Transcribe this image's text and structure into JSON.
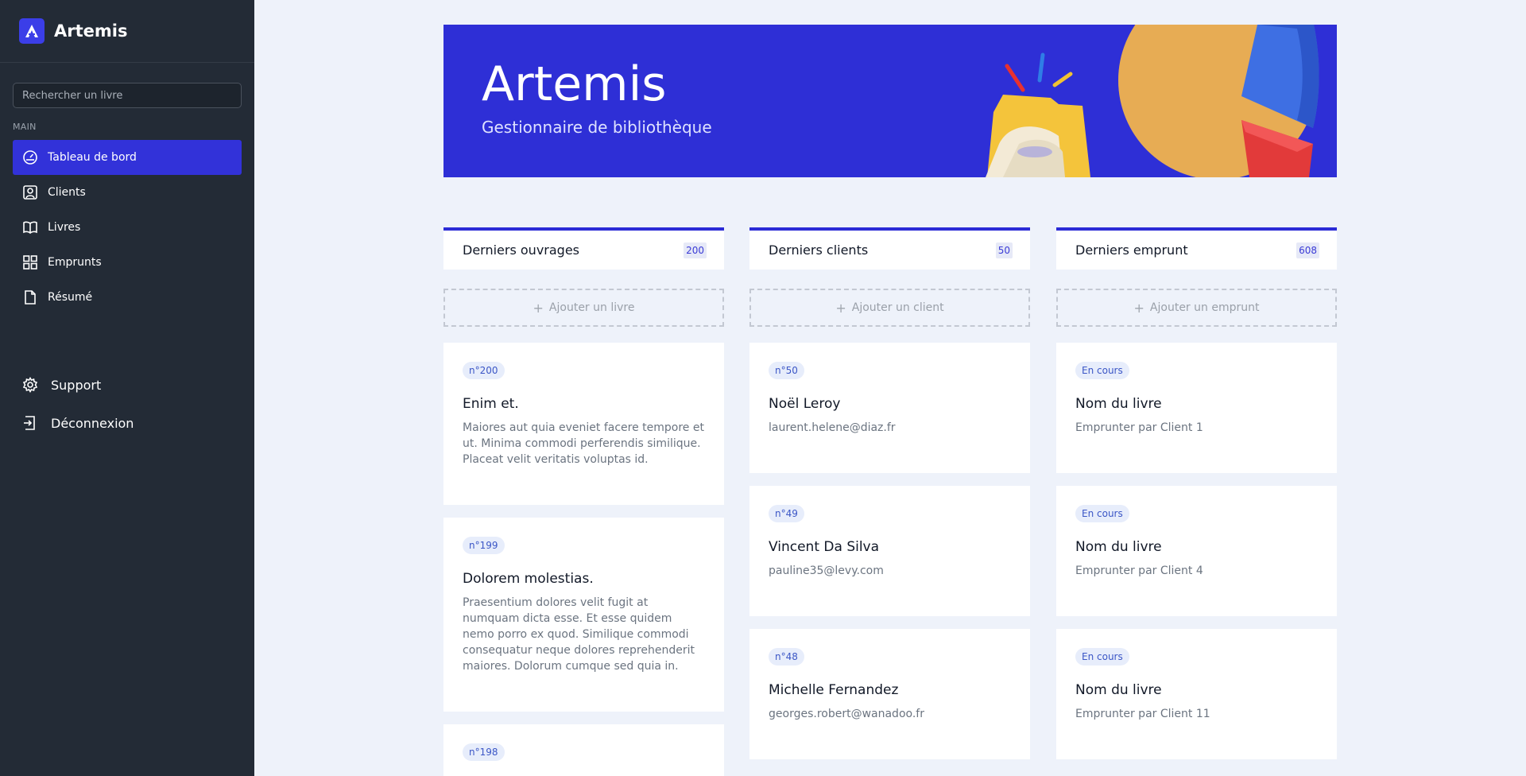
{
  "app": {
    "name": "Artemis"
  },
  "sidebar": {
    "search_placeholder": "Rechercher un livre",
    "section_label": "MAIN",
    "items": [
      {
        "label": "Tableau de bord",
        "icon": "dashboard-icon",
        "active": true
      },
      {
        "label": "Clients",
        "icon": "user-icon"
      },
      {
        "label": "Livres",
        "icon": "book-icon"
      },
      {
        "label": "Emprunts",
        "icon": "grid-icon"
      },
      {
        "label": "Résumé",
        "icon": "file-icon"
      }
    ],
    "bottom": [
      {
        "label": "Support",
        "icon": "gear-icon"
      },
      {
        "label": "Déconnexion",
        "icon": "logout-icon"
      }
    ]
  },
  "hero": {
    "title": "Artemis",
    "subtitle": "Gestionnaire de bibliothèque"
  },
  "colors": {
    "sidebar_bg": "#232b36",
    "accent": "#2e2fd6",
    "page_bg": "#eef2fa"
  },
  "columns": {
    "books": {
      "title": "Derniers ouvrages",
      "count": "200",
      "add_label": "Ajouter un livre",
      "cards": [
        {
          "badge": "n°200",
          "title": "Enim et.",
          "text": "Maiores aut quia eveniet facere tempore et ut. Minima commodi perferendis similique. Placeat velit veritatis voluptas id."
        },
        {
          "badge": "n°199",
          "title": "Dolorem molestias.",
          "text": "Praesentium dolores velit fugit at numquam dicta esse. Et esse quidem nemo porro ex quod. Similique commodi consequatur neque dolores reprehenderit maiores. Dolorum cumque sed quia in."
        },
        {
          "badge": "n°198",
          "title": "",
          "text": ""
        }
      ]
    },
    "clients": {
      "title": "Derniers clients",
      "count": "50",
      "add_label": "Ajouter un client",
      "cards": [
        {
          "badge": "n°50",
          "title": "Noël Leroy",
          "text": "laurent.helene@diaz.fr"
        },
        {
          "badge": "n°49",
          "title": "Vincent Da Silva",
          "text": "pauline35@levy.com"
        },
        {
          "badge": "n°48",
          "title": "Michelle Fernandez",
          "text": "georges.robert@wanadoo.fr"
        }
      ]
    },
    "loans": {
      "title": "Derniers emprunt",
      "count": "608",
      "add_label": "Ajouter un emprunt",
      "cards": [
        {
          "badge": "En cours",
          "title": "Nom du livre",
          "text": "Emprunter par Client 1"
        },
        {
          "badge": "En cours",
          "title": "Nom du livre",
          "text": "Emprunter par Client 4"
        },
        {
          "badge": "En cours",
          "title": "Nom du livre",
          "text": "Emprunter par Client 11"
        }
      ]
    }
  }
}
